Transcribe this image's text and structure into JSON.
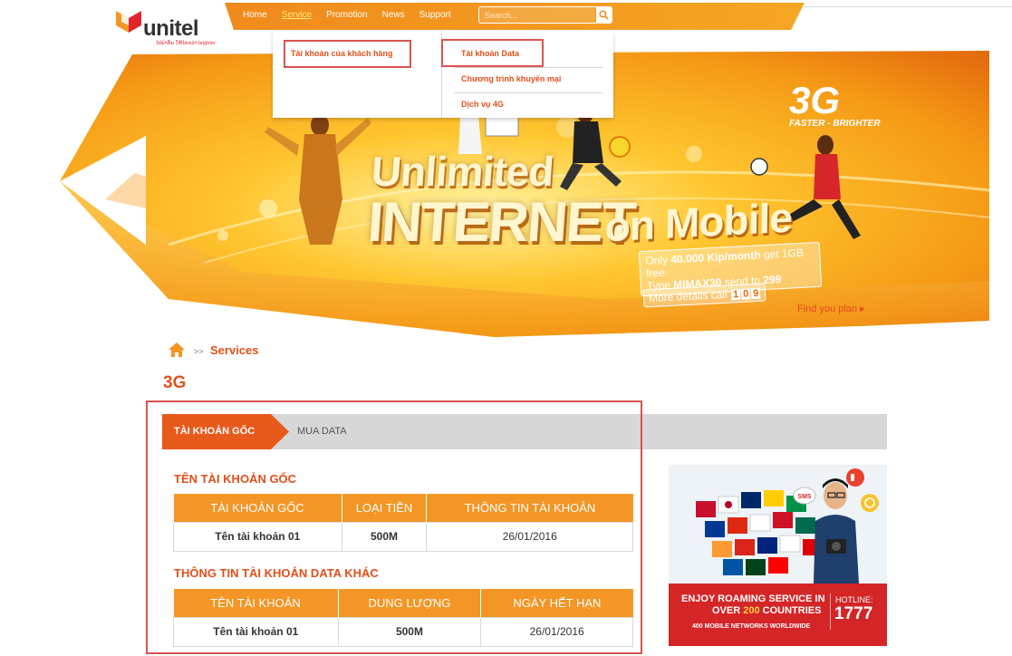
{
  "brand": {
    "name": "unitel",
    "tagline": "ໄປນຳກັນ ໃຫ້ໄກກວ່າ brighter"
  },
  "nav": {
    "items": [
      "Home",
      "Service",
      "Promotion",
      "News",
      "Support"
    ],
    "active": "Service",
    "search_placeholder": "Search..."
  },
  "dropdown": {
    "col1": [
      "Tài khoản của khách hàng"
    ],
    "col2": [
      "Tài khoản Data",
      "Chương trình khuyến mại",
      "Dịch vụ 4G"
    ]
  },
  "banner": {
    "line1": "Unlimited",
    "line2": "INTERNET",
    "line3": "on Mobile",
    "offer_a": "Only ",
    "offer_price": "40.000 Kip/month",
    "offer_b": " get 1GB free",
    "offer_c": "Type ",
    "offer_code": "MIMAX30",
    "offer_d": " send to ",
    "offer_number": "299",
    "details_label": "More details call",
    "details_digits": [
      "1",
      "0",
      "9"
    ],
    "badge": "3G",
    "badge_tagline": "FASTER - BRIGHTER",
    "find_plan": "Find you plan ▸"
  },
  "breadcrumb": {
    "separator": ">>",
    "current": "Services"
  },
  "page_title": "3G",
  "tabs": {
    "active": "TÀI KHOẢN GỐC",
    "inactive": "MUA DATA"
  },
  "section1": {
    "title": "TÊN TÀI KHOẢN GỐC",
    "headers": [
      "TÀI KHOẢN GỐC",
      "LOẠI TIỀN",
      "THÔNG TIN TÀI KHOẢN"
    ],
    "rows": [
      [
        "Tên tài khoản 01",
        "500M",
        "26/01/2016"
      ]
    ]
  },
  "section2": {
    "title": "THÔNG TIN TÀI KHOẢN DATA KHÁC",
    "headers": [
      "TÊN TÀI KHOẢN",
      "DUNG LƯỢNG",
      "NGÀY HẾT HẠN"
    ],
    "rows": [
      [
        "Tên tài khoản 01",
        "500M",
        "26/01/2016"
      ]
    ]
  },
  "ad": {
    "line1": "ENJOY ROAMING SERVICE IN",
    "line2a": "OVER ",
    "line2b": "200",
    "line2c": " COUNTRIES",
    "line3": "400 MOBILE NETWORKS WORLDWIDE",
    "hotline_label": "HOTLINE:",
    "hotline": "1777",
    "bubble": "SMS"
  },
  "colors": {
    "orange": "#f39625",
    "brand_orange": "#e0501b",
    "highlight_red": "#d9534f",
    "tab_gray": "#d7d7d7",
    "ad_red": "#d42527"
  }
}
